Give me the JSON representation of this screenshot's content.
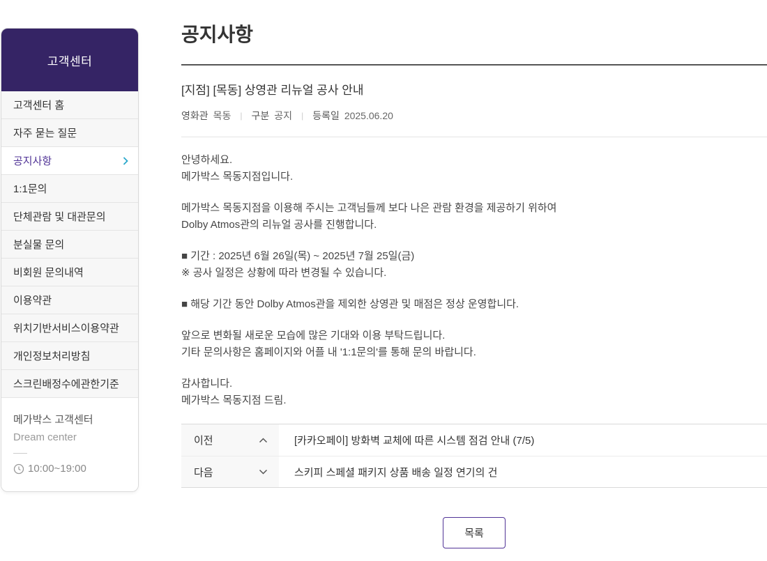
{
  "sidebar": {
    "title": "고객센터",
    "items": [
      {
        "label": "고객센터 홈"
      },
      {
        "label": "자주 묻는 질문"
      },
      {
        "label": "공지사항",
        "active": true
      },
      {
        "label": "1:1문의"
      },
      {
        "label": "단체관람 및 대관문의"
      },
      {
        "label": "분실물 문의"
      },
      {
        "label": "비회원 문의내역"
      },
      {
        "label": "이용약관"
      },
      {
        "label": "위치기반서비스이용약관"
      },
      {
        "label": "개인정보처리방침"
      },
      {
        "label": "스크린배정수에관한기준"
      }
    ],
    "footer": {
      "line1": "메가박스 고객센터",
      "line2": "Dream center",
      "hours": "10:00~19:00"
    }
  },
  "page": {
    "title": "공지사항"
  },
  "notice": {
    "title": "[지점] [목동] 상영관 리뉴얼 공사 안내",
    "meta": {
      "theater_label": "영화관",
      "theater_value": "목동",
      "category_label": "구분",
      "category_value": "공지",
      "date_label": "등록일",
      "date_value": "2025.06.20",
      "separator": "|"
    },
    "body": [
      [
        "안녕하세요.",
        "메가박스 목동지점입니다."
      ],
      [
        "메가박스 목동지점을 이용해 주시는 고객님들께 보다 나은 관람 환경을 제공하기 위하여",
        "Dolby Atmos관의 리뉴얼 공사를 진행합니다."
      ],
      [
        "■ 기간 : 2025년 6월 26일(목) ~ 2025년 7월 25일(금)",
        "※ 공사 일정은 상황에 따라 변경될 수 있습니다."
      ],
      [
        "■ 해당 기간 동안 Dolby Atmos관을 제외한 상영관 및 매점은 정상 운영합니다."
      ],
      [
        "앞으로 변화될 새로운 모습에 많은 기대와 이용 부탁드립니다.",
        "기타 문의사항은 홈페이지와 어플 내 '1:1문의'를 통해 문의 바랍니다."
      ],
      [
        "감사합니다.",
        "메가박스 목동지점 드림."
      ]
    ]
  },
  "nav": {
    "prev_label": "이전",
    "prev_title": "[카카오페이] 방화벽 교체에 따른 시스템 점검 안내 (7/5)",
    "next_label": "다음",
    "next_title": "스키피 스페셜 패키지 상품 배송 일정 연기의 건"
  },
  "actions": {
    "list_label": "목록"
  },
  "colors": {
    "header_purple": "#352465",
    "brand_purple": "#503396",
    "accent_teal": "#2aa8cc"
  }
}
